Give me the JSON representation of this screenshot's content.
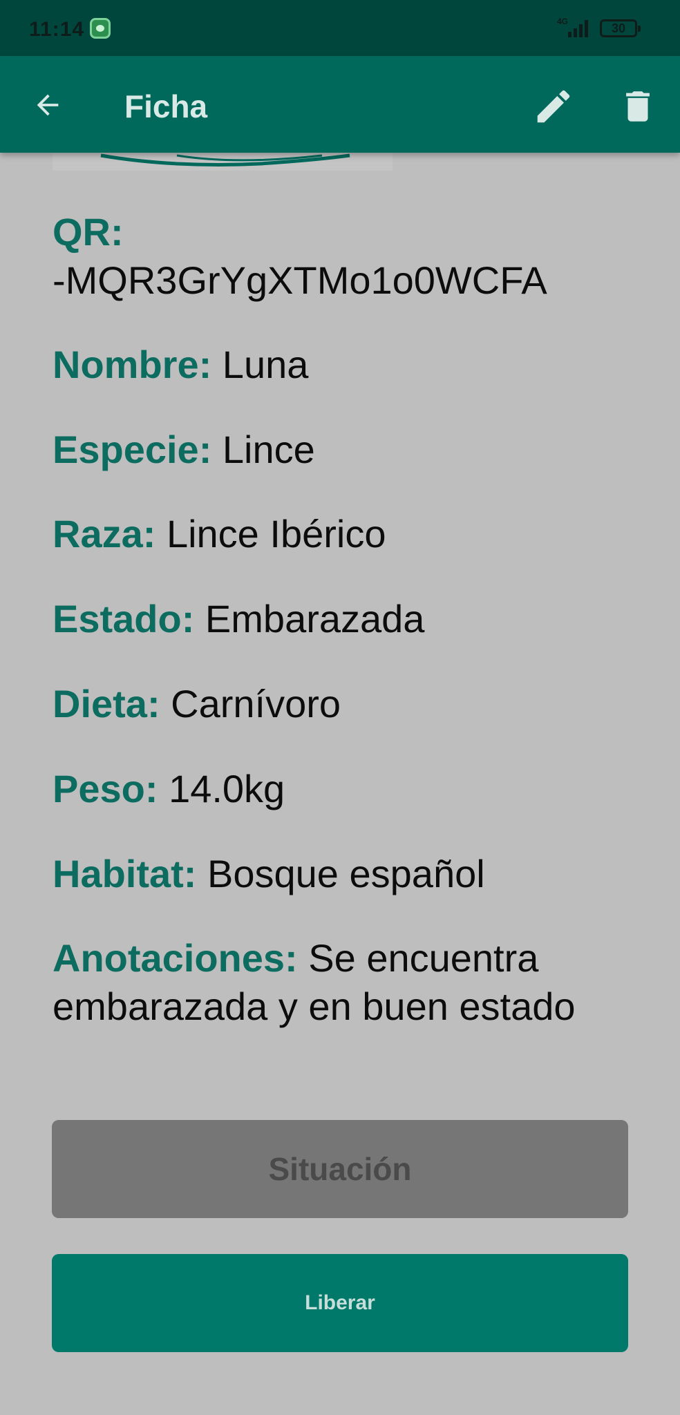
{
  "status_bar": {
    "time": "11:14",
    "network": "4G",
    "battery": "30"
  },
  "app_bar": {
    "title": "Ficha",
    "icons": [
      "arrow-back-icon",
      "pencil-icon",
      "trash-icon"
    ]
  },
  "details": {
    "qr_label": "QR:",
    "qr_value": "-MQR3GrYgXTMo1o0WCFA",
    "nombre_label": "Nombre:",
    "nombre_value": "Luna",
    "especie_label": "Especie:",
    "especie_value": "Lince",
    "raza_label": "Raza:",
    "raza_value": "Lince Ibérico",
    "estado_label": "Estado:",
    "estado_value": "Embarazada",
    "dieta_label": "Dieta:",
    "dieta_value": "Carnívoro",
    "peso_label": "Peso:",
    "peso_value": "14.0kg",
    "habitat_label": "Habitat:",
    "habitat_value": "Bosque español",
    "anotaciones_label": "Anotaciones:",
    "anotaciones_value": "Se encuentra embarazada y en buen estado"
  },
  "buttons": {
    "situacion": "Situación",
    "liberar": "Liberar"
  },
  "colors": {
    "primary": "#00695c",
    "status_bar": "#00463d",
    "label": "#0c6c5f",
    "background": "#bebebe",
    "disabled_button": "#767676",
    "action_button": "#00796b"
  }
}
